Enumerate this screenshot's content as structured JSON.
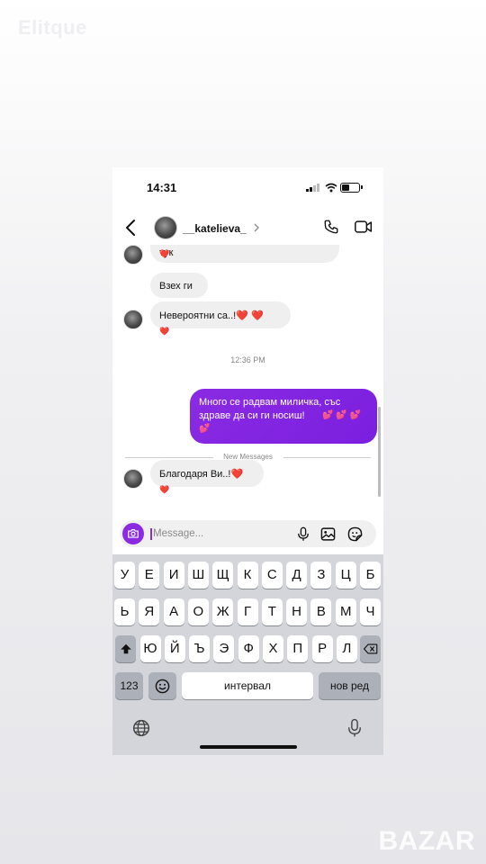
{
  "watermarks": {
    "top": "Elitque",
    "bottom": "BAZAR"
  },
  "status_bar": {
    "time": "14:31"
  },
  "header": {
    "username": "__katelieva_"
  },
  "messages": {
    "m1": {
      "text": "тук",
      "reaction": "❤️"
    },
    "m2": {
      "text": "Взех ги"
    },
    "m3": {
      "text": "Невероятни са..!❤️ ❤️",
      "reaction": "❤️"
    },
    "timestamp": "12:36 PM",
    "outgoing": {
      "line1": "Много се радвам миличка, със",
      "line2": "здраве да си ги носиш!",
      "hearts": "💕 💕 💕",
      "hearts2": "💕"
    },
    "new_messages_label": "New Messages",
    "m4": {
      "text": "Благодаря Ви..!❤️",
      "reaction": "❤️"
    }
  },
  "composer": {
    "placeholder": "Message..."
  },
  "keyboard": {
    "row1": [
      "У",
      "Е",
      "И",
      "Ш",
      "Щ",
      "К",
      "С",
      "Д",
      "З",
      "Ц",
      "Б"
    ],
    "row2": [
      "Ь",
      "Я",
      "А",
      "О",
      "Ж",
      "Г",
      "Т",
      "Н",
      "В",
      "М",
      "Ч"
    ],
    "row3": [
      "Ю",
      "Й",
      "Ъ",
      "Э",
      "Ф",
      "Х",
      "П",
      "Р",
      "Л"
    ],
    "numbers_label": "123",
    "space_label": "интервал",
    "return_label": "нов ред"
  },
  "colors": {
    "accent": "#8a2be2",
    "heart": "#e0162b",
    "keyboard_bg": "#d3d5da"
  },
  "icons": [
    "back-chevron-icon",
    "phone-icon",
    "video-icon",
    "camera-icon",
    "mic-icon",
    "image-icon",
    "sticker-icon",
    "shift-icon",
    "backspace-icon",
    "emoji-icon",
    "globe-icon",
    "dictation-mic-icon"
  ]
}
